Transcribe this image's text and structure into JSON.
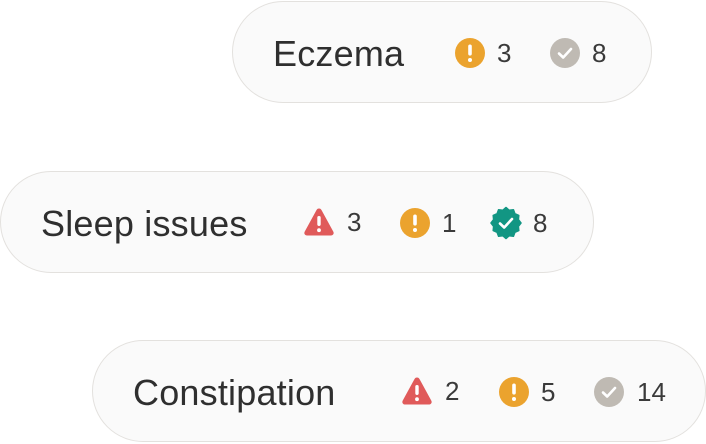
{
  "conditions": [
    {
      "label": "Eczema",
      "stats": [
        {
          "icon": "warning-circle-icon",
          "count": "3",
          "color": "#EBA32E"
        },
        {
          "icon": "check-circle-icon",
          "count": "8",
          "color": "#BFBAB3"
        }
      ]
    },
    {
      "label": "Sleep issues",
      "stats": [
        {
          "icon": "alert-triangle-icon",
          "count": "3",
          "color": "#E05A5A"
        },
        {
          "icon": "warning-circle-icon",
          "count": "1",
          "color": "#EBA32E"
        },
        {
          "icon": "verified-badge-icon",
          "count": "8",
          "color": "#129683"
        }
      ]
    },
    {
      "label": "Constipation",
      "stats": [
        {
          "icon": "alert-triangle-icon",
          "count": "2",
          "color": "#E05A5A"
        },
        {
          "icon": "warning-circle-icon",
          "count": "5",
          "color": "#EBA32E"
        },
        {
          "icon": "check-circle-icon",
          "count": "14",
          "color": "#BFBAB3"
        }
      ]
    }
  ]
}
